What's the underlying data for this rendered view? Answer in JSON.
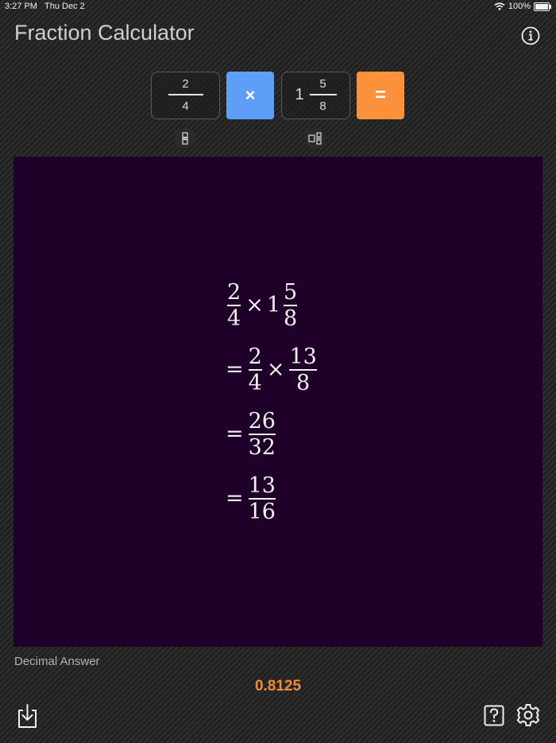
{
  "status_bar": {
    "time": "3:27 PM",
    "day": "Thu Dec 2",
    "battery": "100%"
  },
  "header": {
    "title": "Fraction Calculator",
    "info_icon": "info-circle-icon"
  },
  "input": {
    "first": {
      "numerator": "2",
      "denominator": "4"
    },
    "operator": "×",
    "second": {
      "whole": "1",
      "numerator": "5",
      "denominator": "8"
    },
    "equals": "=",
    "colors": {
      "operator_bg": "#5e9ef7",
      "equals_bg": "#fb913b"
    }
  },
  "steps": {
    "line1": {
      "a_num": "2",
      "a_den": "4",
      "op": "×",
      "b_whole": "1",
      "b_num": "5",
      "b_den": "8"
    },
    "line2": {
      "eq": "=",
      "a_num": "2",
      "a_den": "4",
      "op": "×",
      "b_num": "13",
      "b_den": "8"
    },
    "line3": {
      "eq": "=",
      "num": "26",
      "den": "32"
    },
    "line4": {
      "eq": "=",
      "num": "13",
      "den": "16"
    },
    "background": "#1e0028"
  },
  "result": {
    "label": "Decimal Answer",
    "value": "0.8125",
    "color": "#f08b3c"
  },
  "footer": {
    "export_icon": "export-icon",
    "help_icon": "help-icon",
    "settings_icon": "gear-icon"
  }
}
